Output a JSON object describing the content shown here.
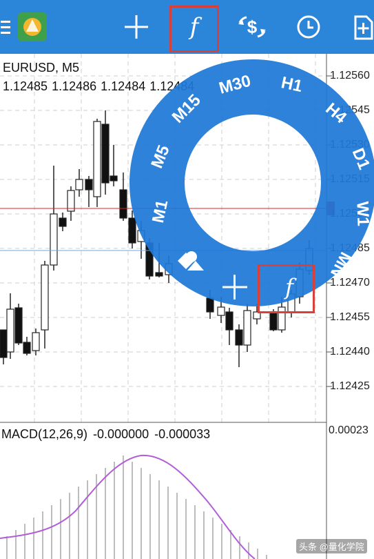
{
  "toolbar": {
    "icons": [
      "menu-icon",
      "mt-logo-icon",
      "crosshair-icon",
      "indicators-icon",
      "trade-icon",
      "history-icon",
      "new-order-icon"
    ],
    "function_glyph": "f",
    "accent_color": "#2b86d9",
    "highlight_color": "#d8403a"
  },
  "chart": {
    "symbol": "EURUSD, M5",
    "quotes": [
      "1.12485",
      "1.12486",
      "1.12484",
      "1.12484"
    ],
    "price_labels": [
      "1.12560",
      "1.12545",
      "1.12530",
      "1.12515",
      "1.12500",
      "1.12485",
      "1.12470",
      "1.12455",
      "1.12440",
      "1.12425"
    ],
    "current_price_color": "#e02020"
  },
  "timeframe_wheel": {
    "timeframes": [
      "M1",
      "M5",
      "M15",
      "M30",
      "H1",
      "H4",
      "D1",
      "W1",
      "MN"
    ],
    "tools": [
      "objects-icon",
      "crosshair-icon",
      "indicators-icon"
    ],
    "function_glyph": "f"
  },
  "indicator": {
    "name": "MACD(12,26,9)",
    "value_main": "-0.000000",
    "value_signal": "-0.000033",
    "scale_top": "0.00023",
    "line_color": "#b05ed6"
  },
  "watermark": "头条 @量化学院"
}
